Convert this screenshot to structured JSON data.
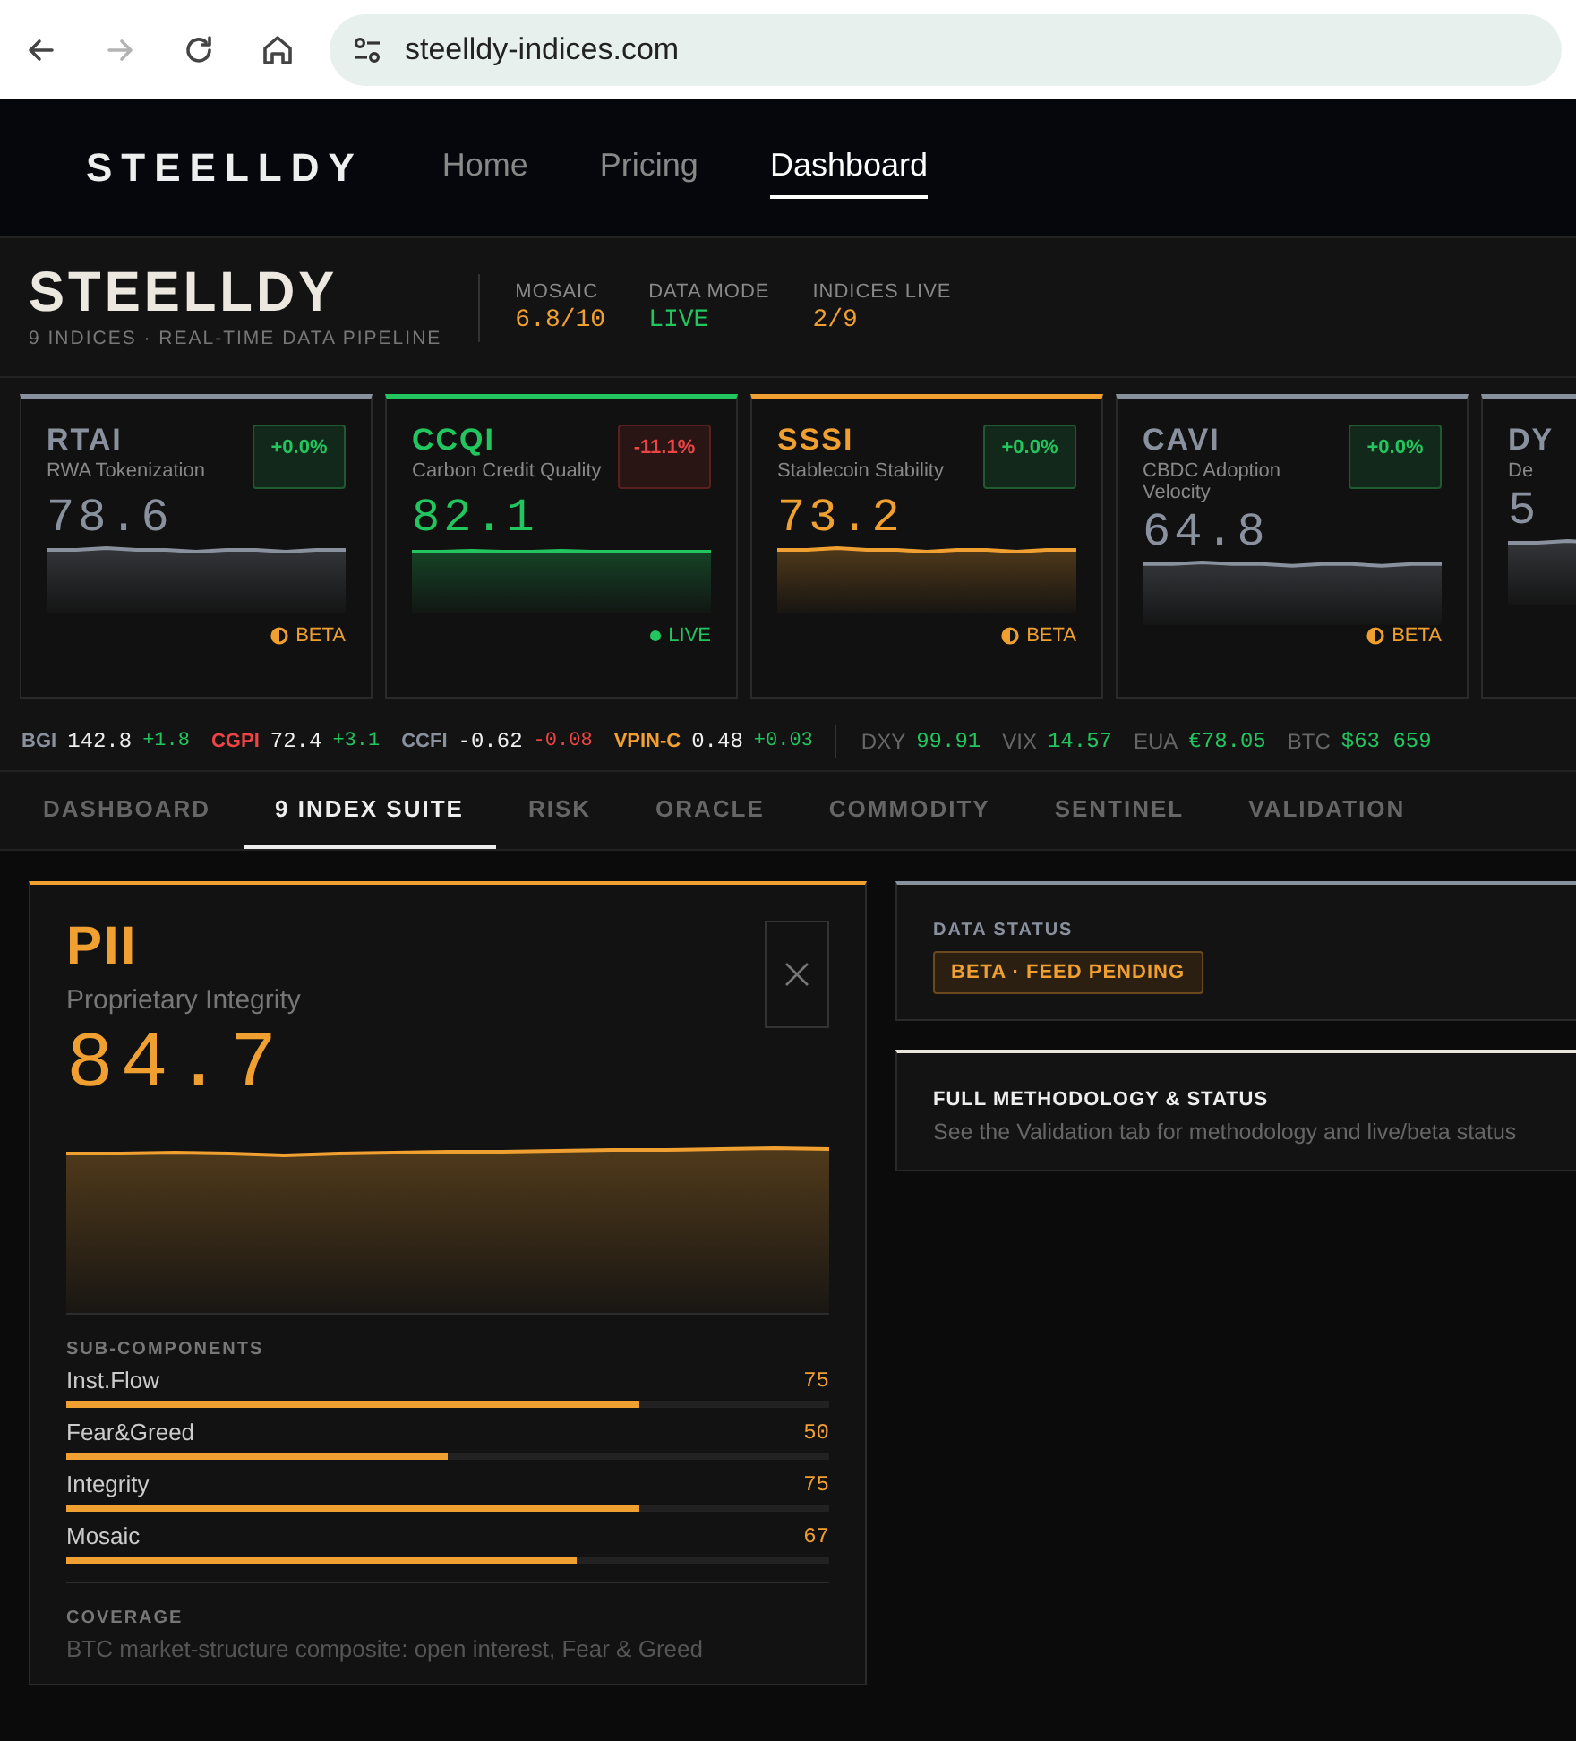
{
  "browser": {
    "url": "steelldy-indices.com",
    "back_disabled": false,
    "forward_disabled": true
  },
  "nav": {
    "logo": "STEELLDY",
    "links": [
      {
        "label": "Home",
        "selected": false
      },
      {
        "label": "Pricing",
        "selected": false
      },
      {
        "label": "Dashboard",
        "selected": true
      }
    ]
  },
  "brand": {
    "title": "STEELLDY",
    "subtitle": "9 INDICES · REAL-TIME DATA PIPELINE",
    "stats": [
      {
        "label": "MOSAIC",
        "value": "6.8/10",
        "color": "#f0a030"
      },
      {
        "label": "DATA MODE",
        "value": "LIVE",
        "color": "#22c55e"
      },
      {
        "label": "INDICES LIVE",
        "value": "2/9",
        "color": "#f0a030"
      }
    ]
  },
  "cards": [
    {
      "code": "RTAI",
      "name": "RWA Tokenization",
      "value": "78.6",
      "change": "+0.0%",
      "negative": false,
      "status": "BETA",
      "kind": "beta",
      "color": "#8a919e"
    },
    {
      "code": "CCQI",
      "name": "Carbon Credit Quality",
      "value": "82.1",
      "change": "-11.1%",
      "negative": true,
      "status": "LIVE",
      "kind": "live",
      "color": "#22c55e"
    },
    {
      "code": "SSSI",
      "name": "Stablecoin Stability",
      "value": "73.2",
      "change": "+0.0%",
      "negative": false,
      "status": "BETA",
      "kind": "beta",
      "color": "#f0a030"
    },
    {
      "code": "CAVI",
      "name": "CBDC Adoption Velocity",
      "value": "64.8",
      "change": "+0.0%",
      "negative": false,
      "status": "BETA",
      "kind": "beta",
      "color": "#8a919e"
    },
    {
      "code": "DY",
      "name": "De",
      "value": "5",
      "kind": "partial",
      "color": "#8a919e"
    }
  ],
  "ticker": [
    {
      "code": "BGI",
      "value": "142.8",
      "change": "+1.8",
      "negative": false,
      "color": "#8a919e"
    },
    {
      "code": "CGPI",
      "value": "72.4",
      "change": "+3.1",
      "negative": false,
      "color": "#ef4444"
    },
    {
      "code": "CCFI",
      "value": "-0.62",
      "change": "-0.08",
      "negative": true,
      "color": "#8a919e"
    },
    {
      "code": "VPIN-C",
      "value": "0.48",
      "change": "+0.03",
      "negative": false,
      "color": "#f0a030"
    }
  ],
  "markets": [
    {
      "label": "DXY",
      "value": "99.91"
    },
    {
      "label": "VIX",
      "value": "14.57"
    },
    {
      "label": "EUA",
      "value": "€78.05"
    },
    {
      "label": "BTC",
      "value": "$63 659"
    }
  ],
  "tabs": [
    {
      "label": "DASHBOARD",
      "selected": false
    },
    {
      "label": "9 INDEX SUITE",
      "selected": true
    },
    {
      "label": "RISK",
      "selected": false
    },
    {
      "label": "ORACLE",
      "selected": false
    },
    {
      "label": "COMMODITY",
      "selected": false
    },
    {
      "label": "SENTINEL",
      "selected": false
    },
    {
      "label": "VALIDATION",
      "selected": false
    }
  ],
  "detail": {
    "code": "PII",
    "name": "Proprietary Integrity",
    "value": "84.7",
    "subcomponents_title": "SUB-COMPONENTS",
    "subcomponents": [
      {
        "name": "Inst.Flow",
        "reading": "75",
        "level": 0.75
      },
      {
        "name": "Fear&Greed",
        "reading": "50",
        "level": 0.5
      },
      {
        "name": "Integrity",
        "reading": "75",
        "level": 0.75
      },
      {
        "name": "Mosaic",
        "reading": "67",
        "level": 0.67
      }
    ],
    "coverage_title": "COVERAGE",
    "coverage": "BTC market-structure composite: open interest, Fear & Greed"
  },
  "data_status": {
    "title": "DATA STATUS",
    "badge": "BETA · FEED PENDING"
  },
  "methodology": {
    "title": "FULL METHODOLOGY & STATUS",
    "text": "See the Validation tab for methodology and live/beta status"
  }
}
